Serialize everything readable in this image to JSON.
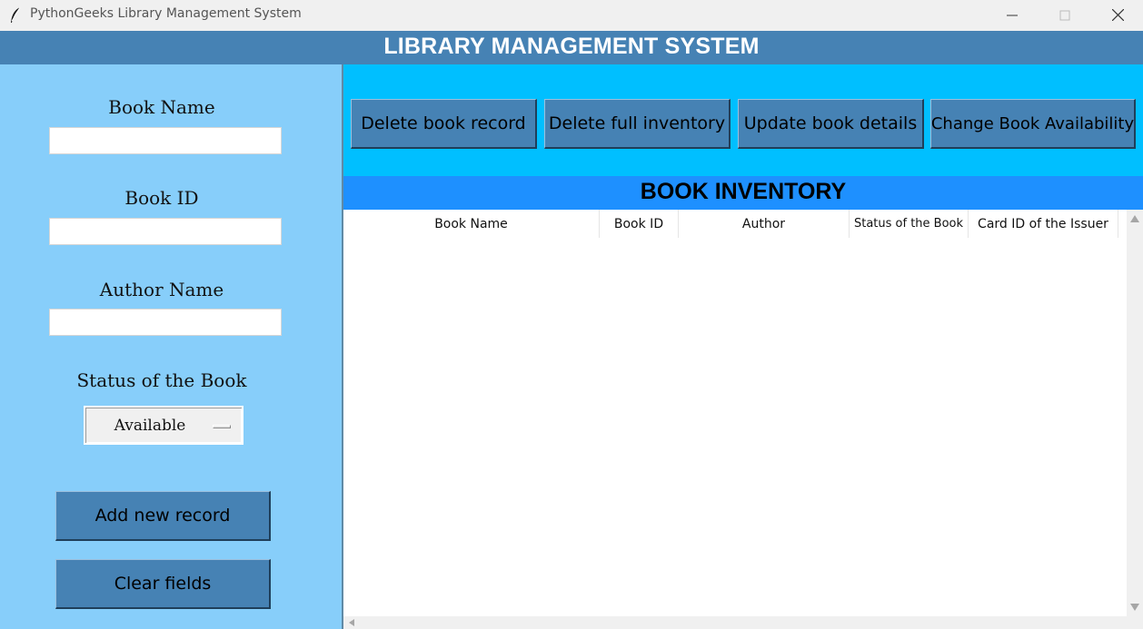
{
  "window": {
    "title": "PythonGeeks Library Management System",
    "icon": "feather-icon"
  },
  "header": {
    "title": "LIBRARY MANAGEMENT SYSTEM"
  },
  "form": {
    "book_name_label": "Book Name",
    "book_name_value": "",
    "book_id_label": "Book ID",
    "book_id_value": "",
    "author_label": "Author Name",
    "author_value": "",
    "status_label": "Status of the Book",
    "status_value": "Available",
    "add_button": "Add new record",
    "clear_button": "Clear fields"
  },
  "actions": {
    "delete_record": "Delete book record",
    "delete_inventory": "Delete full inventory",
    "update_details": "Update book details",
    "change_availability": "Change Book Availability"
  },
  "inventory": {
    "title": "BOOK INVENTORY",
    "columns": [
      "Book Name",
      "Book ID",
      "Author",
      "Status of the Book",
      "Card ID of the Issuer"
    ],
    "rows": []
  },
  "colors": {
    "header_bg": "#4682b4",
    "left_panel_bg": "#87cefa",
    "button_strip_bg": "#00bfff",
    "inventory_header_bg": "#1e90ff",
    "button_bg": "#4682b4"
  }
}
